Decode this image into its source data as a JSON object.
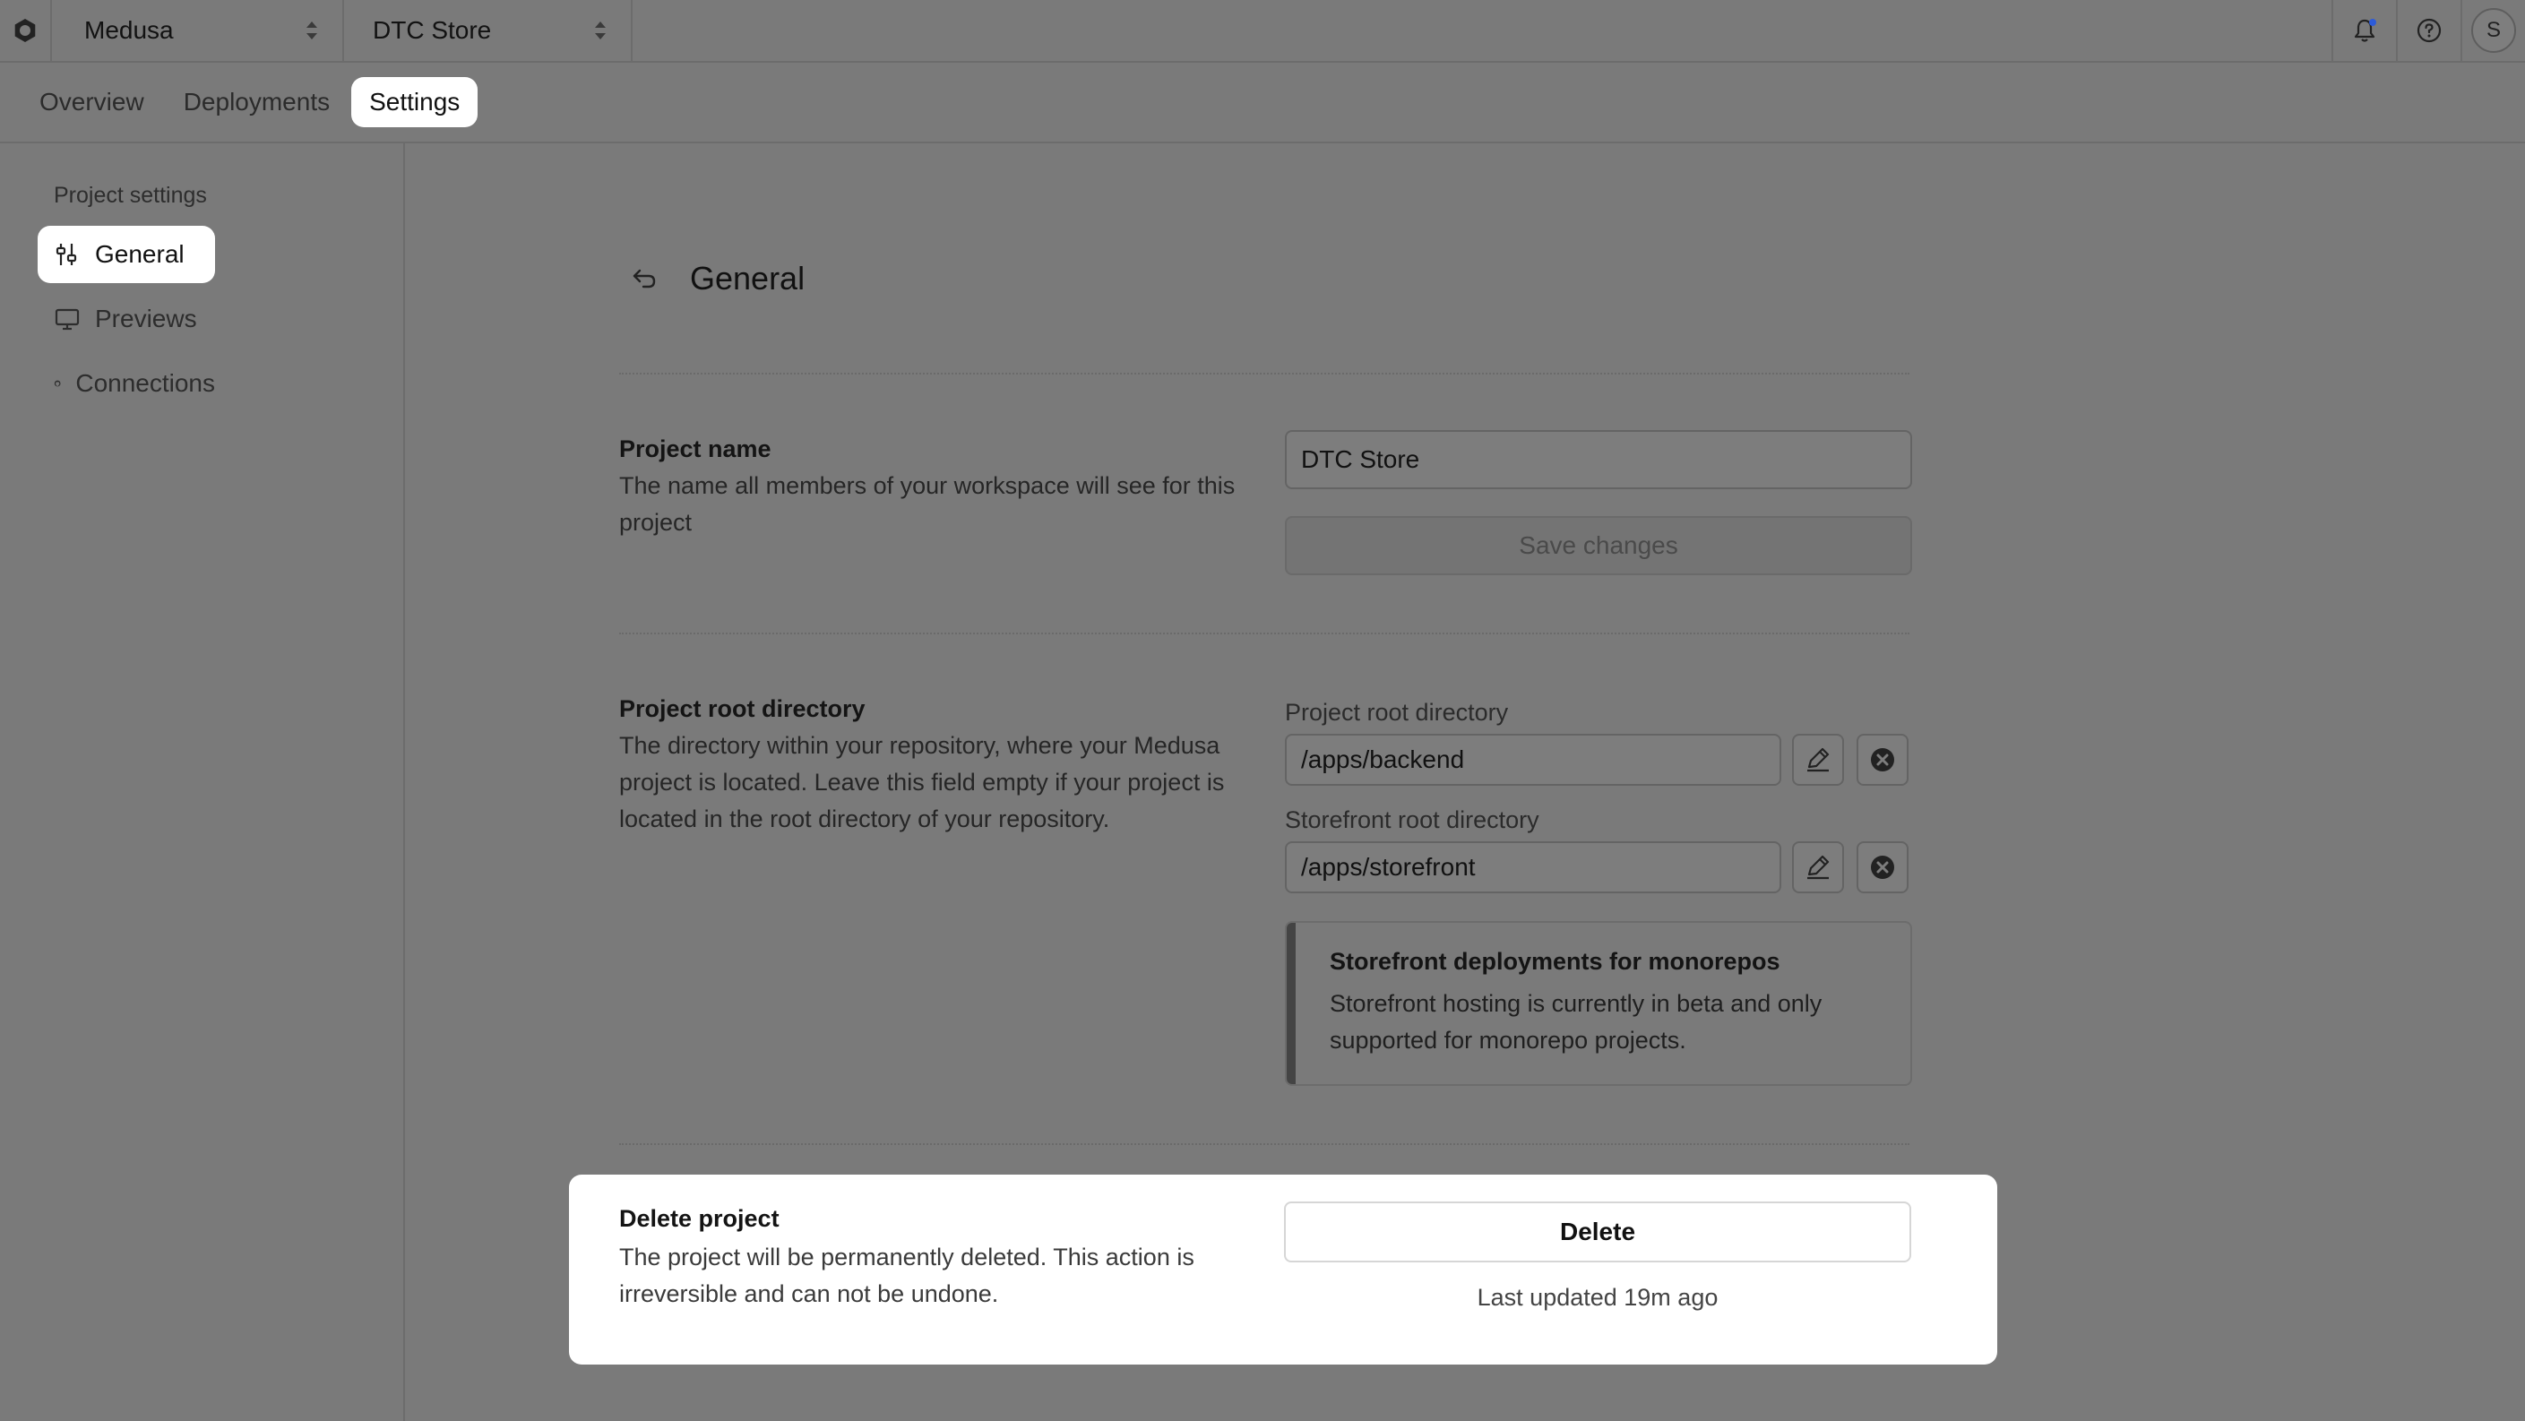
{
  "topbar": {
    "org_name": "Medusa",
    "project_name": "DTC Store",
    "avatar_initial": "S"
  },
  "tabs": [
    {
      "label": "Overview"
    },
    {
      "label": "Deployments"
    },
    {
      "label": "Settings",
      "active": true
    }
  ],
  "sidebar": {
    "heading": "Project settings",
    "items": [
      {
        "label": "General",
        "icon": "sliders-icon",
        "active": true
      },
      {
        "label": "Previews",
        "icon": "monitor-icon"
      },
      {
        "label": "Connections",
        "icon": "github-icon"
      }
    ]
  },
  "page": {
    "title": "General"
  },
  "project_name_section": {
    "title": "Project name",
    "description": "The name all members of your workspace will see for this project",
    "value": "DTC Store",
    "save_label": "Save changes"
  },
  "root_dir_section": {
    "title": "Project root directory",
    "description": "The directory within your repository, where your Medusa project is located. Leave this field empty if your project is located in the root directory of your repository.",
    "project_root_label": "Project root directory",
    "project_root_value": "/apps/backend",
    "storefront_root_label": "Storefront root directory",
    "storefront_root_value": "/apps/storefront",
    "callout_title": "Storefront deployments for monorepos",
    "callout_body": "Storefront hosting is currently in beta and only supported for monorepo projects."
  },
  "delete_section": {
    "title": "Delete project",
    "description": "The project will be permanently deleted. This action is irreversible and can not be undone.",
    "button_label": "Delete",
    "last_updated": "Last updated 19m ago"
  },
  "colors": {
    "overlay_bg": "#7a7a7a",
    "card_bg": "#ffffff",
    "notification_dot": "#2d5bd8"
  }
}
